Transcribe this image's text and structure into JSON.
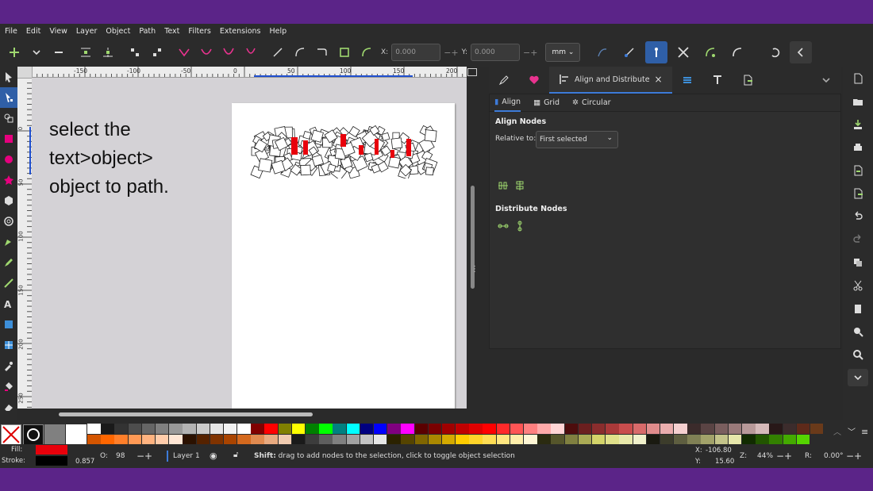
{
  "menu": [
    "File",
    "Edit",
    "View",
    "Layer",
    "Object",
    "Path",
    "Text",
    "Filters",
    "Extensions",
    "Help"
  ],
  "toolbar": {
    "x_label": "X:",
    "x_value": "0.000",
    "y_label": "Y:",
    "y_value": "0.000",
    "unit": "mm"
  },
  "ruler": {
    "top_ticks": [
      "-150",
      "-100",
      "-50",
      "0",
      "50",
      "100",
      "150",
      "200"
    ],
    "left_ticks": [
      "0",
      "50",
      "100",
      "150",
      "200",
      "250"
    ]
  },
  "note_text": "select the text>object> object to path.",
  "dock": {
    "active_tab": "Align and Distribute",
    "close": "×"
  },
  "align": {
    "tabs": [
      "Align",
      "Grid",
      "Circular"
    ],
    "align_nodes": "Align Nodes",
    "relative_label": "Relative to:",
    "relative_value": "First selected",
    "distribute_nodes": "Distribute Nodes"
  },
  "status": {
    "fill_label": "Fill:",
    "stroke_label": "Stroke:",
    "stroke_width": "0.857",
    "opacity_label": "O:",
    "opacity": "98",
    "layer": "Layer 1",
    "message_bold": "Shift:",
    "message": " drag to add nodes to the selection, click to toggle object selection",
    "x_label": "X:",
    "x": "-106.80",
    "y_label": "Y:",
    "y": "15.60",
    "zoom_label": "Z:",
    "zoom": "44%",
    "rotate_label": "R:",
    "rotate": "0.00°"
  },
  "colors": {
    "fill": "#e8000b",
    "stroke": "#000000",
    "accent": "#3d7bd9"
  },
  "palette_row1": [
    "#ffffff",
    "#1a1a1a",
    "#333333",
    "#4d4d4d",
    "#666666",
    "#808080",
    "#999999",
    "#b3b3b3",
    "#cccccc",
    "#e6e6e6",
    "#f2f2f2",
    "#ffffff",
    "#800000",
    "#ff0000",
    "#808000",
    "#ffff00",
    "#008000",
    "#00ff00",
    "#008080",
    "#00ffff",
    "#000080",
    "#0000ff",
    "#800080",
    "#ff00ff",
    "#5a0000",
    "#7a0000",
    "#a00000",
    "#c00000",
    "#e00000",
    "#ff0000",
    "#ff2a2a",
    "#ff5555",
    "#ff8080",
    "#ffaaaa",
    "#ffd5d5",
    "#4d0d0d",
    "#6b1f1f",
    "#8a2d2d",
    "#aa3939",
    "#c94d4d",
    "#d86a6a",
    "#e08c8c",
    "#eaadad",
    "#f5d0d0",
    "#3b2b2b",
    "#5a4444",
    "#7a5e5e",
    "#9a7a7a",
    "#b89999",
    "#d6baba",
    "#281818",
    "#3c2c2c",
    "#5e2a1a",
    "#6a3a1a"
  ],
  "palette_row2": [
    "#d45500",
    "#ff6600",
    "#ff7f2a",
    "#ff9955",
    "#ffb380",
    "#ffccaa",
    "#ffe6d5",
    "#2b1100",
    "#552200",
    "#803300",
    "#aa4400",
    "#d4691e",
    "#e08a50",
    "#e8aa80",
    "#f0cbb0",
    "#1a1a1a",
    "#3c3c3c",
    "#5e5e5e",
    "#808080",
    "#a2a2a2",
    "#c4c4c4",
    "#e6e6e6",
    "#2b2200",
    "#554400",
    "#806600",
    "#aa8800",
    "#d4aa00",
    "#ffcc00",
    "#ffd42a",
    "#ffdd55",
    "#ffe680",
    "#ffeeaa",
    "#fff6d5",
    "#2b2b11",
    "#55552b",
    "#808040",
    "#aaaa55",
    "#d4d46a",
    "#e0e08a",
    "#e8e8aa",
    "#f0f0cb",
    "#1a1a11",
    "#3c3c2b",
    "#5e5e40",
    "#808055",
    "#a2a26a",
    "#c4c48a",
    "#e6e6aa",
    "#112b00",
    "#225500",
    "#338000",
    "#44aa00",
    "#55d400"
  ]
}
